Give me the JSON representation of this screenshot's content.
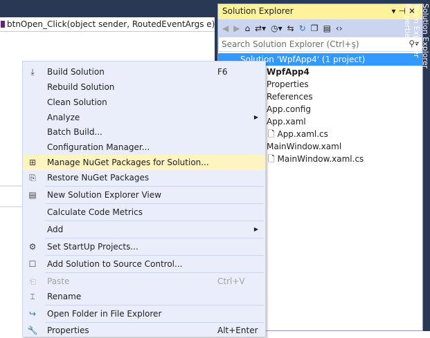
{
  "editor": {
    "nav_member": "btnOpen_Click(object sender, RoutedEventArgs e)"
  },
  "solution_explorer": {
    "title": "Solution Explorer",
    "search_placeholder": "Search Solution Explorer (Ctrl+ş)",
    "tree": [
      {
        "label": "Solution 'WpfApp4' (1 project)",
        "selected": true
      },
      {
        "label": "WpfApp4",
        "bold": true
      },
      {
        "label": "Properties"
      },
      {
        "label": "References"
      },
      {
        "label": "App.config"
      },
      {
        "label": "App.xaml"
      },
      {
        "label": "App.xaml.cs",
        "child": true
      },
      {
        "label": "MainWindow.xaml"
      },
      {
        "label": "MainWindow.xaml.cs",
        "child": true
      }
    ]
  },
  "side_tabs": [
    "Solution Explorer",
    "Team Explorer",
    "Properties"
  ],
  "context_menu": [
    {
      "label": "Build Solution",
      "shortcut": "F6",
      "icon": "build-icon"
    },
    {
      "label": "Rebuild Solution"
    },
    {
      "label": "Clean Solution"
    },
    {
      "label": "Analyze",
      "submenu": true
    },
    {
      "label": "Batch Build..."
    },
    {
      "label": "Configuration Manager..."
    },
    {
      "label": "Manage NuGet Packages for Solution...",
      "icon": "nuget-icon",
      "highlighted": true
    },
    {
      "label": "Restore NuGet Packages",
      "icon": "restore-icon"
    },
    {
      "label": "New Solution Explorer View",
      "icon": "new-view-icon"
    },
    {
      "label": "Calculate Code Metrics"
    },
    {
      "label": "Add",
      "submenu": true
    },
    {
      "label": "Set StartUp Projects...",
      "icon": "gear-icon"
    },
    {
      "label": "Add Solution to Source Control...",
      "icon": "source-control-icon"
    },
    {
      "label": "Paste",
      "shortcut": "Ctrl+V",
      "icon": "paste-icon",
      "disabled": true
    },
    {
      "label": "Rename",
      "icon": "rename-icon"
    },
    {
      "label": "Open Folder in File Explorer",
      "icon": "open-folder-icon"
    },
    {
      "label": "Properties",
      "shortcut": "Alt+Enter",
      "icon": "wrench-icon"
    }
  ]
}
